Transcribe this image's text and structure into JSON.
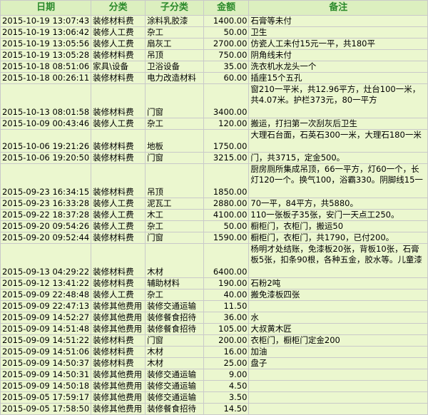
{
  "columns": [
    "日期",
    "分类",
    "子分类",
    "金额",
    "备注"
  ],
  "rows": [
    {
      "date": "2015-10-19 13:07:43",
      "category": "装修材料费",
      "subcategory": "涂料乳胶漆",
      "amount": "1400.00",
      "note": "石膏等未付"
    },
    {
      "date": "2015-10-19 13:06:42",
      "category": "装修人工费",
      "subcategory": "杂工",
      "amount": "50.00",
      "note": "卫生"
    },
    {
      "date": "2015-10-19 13:05:56",
      "category": "装修人工费",
      "subcategory": "扇灰工",
      "amount": "2700.00",
      "note": "仿瓷人工未付15元一平，共180平"
    },
    {
      "date": "2015-10-19 13:05:28",
      "category": "装修材料费",
      "subcategory": "吊顶",
      "amount": "750.00",
      "note": "阴角线未付"
    },
    {
      "date": "2015-10-18 08:51:06",
      "category": "家具\\设备",
      "subcategory": "卫浴设备",
      "amount": "35.00",
      "note": "洗衣机水龙头一个"
    },
    {
      "date": "2015-10-18 00:26:11",
      "category": "装修材料费",
      "subcategory": "电力改造材料",
      "amount": "60.00",
      "note": "插座15个五孔"
    },
    {
      "date": "2015-10-13 08:01:58",
      "category": "装修材料费",
      "subcategory": "门窗",
      "amount": "3400.00",
      "note": "窗210一平米，共12.96平方，灶台100一米，共4.07米。护栏373元，80一平方"
    },
    {
      "date": "2015-10-09 00:43:46",
      "category": "装修人工费",
      "subcategory": "杂工",
      "amount": "120.00",
      "note": "搬运，打扫第一次刮灰后卫生"
    },
    {
      "date": "2015-10-06 19:21:26",
      "category": "装修材料费",
      "subcategory": "地板",
      "amount": "1750.00",
      "note": "大理石台面，石英石300一米，大理石180一米"
    },
    {
      "date": "2015-10-06 19:20:50",
      "category": "装修材料费",
      "subcategory": "门窗",
      "amount": "3215.00",
      "note": "门，共3715，定金500。"
    },
    {
      "date": "2015-09-23 16:34:15",
      "category": "装修材料费",
      "subcategory": "吊顶",
      "amount": "1850.00",
      "note": "厨房厕所集成吊顶，66一平方，灯60一个，长灯120一个。换气100，浴霸330。阴脚线15一"
    },
    {
      "date": "2015-09-23 16:33:28",
      "category": "装修人工费",
      "subcategory": "泥瓦工",
      "amount": "2880.00",
      "note": "70一平，84平方，共5880。"
    },
    {
      "date": "2015-09-22 18:37:28",
      "category": "装修人工费",
      "subcategory": "木工",
      "amount": "4100.00",
      "note": "110一张板子35张，安门一天点工250。"
    },
    {
      "date": "2015-09-20 09:54:26",
      "category": "装修人工费",
      "subcategory": "杂工",
      "amount": "50.00",
      "note": "橱柜门，衣柜门，搬运50"
    },
    {
      "date": "2015-09-20 09:52:44",
      "category": "装修材料费",
      "subcategory": "门窗",
      "amount": "1590.00",
      "note": "橱柜门，衣柜门，共1790，已付200。"
    },
    {
      "date": "2015-09-13 04:29:22",
      "category": "装修材料费",
      "subcategory": "木材",
      "amount": "6400.00",
      "note": "杨明才处结账，免漆板20张，背板10张，石膏板5张，扣条90根，各种五金，胶水等。儿童漆"
    },
    {
      "date": "2015-09-12 13:41:22",
      "category": "装修材料费",
      "subcategory": "辅助材料",
      "amount": "190.00",
      "note": "石粉2吨"
    },
    {
      "date": "2015-09-09 22:48:48",
      "category": "装修人工费",
      "subcategory": "杂工",
      "amount": "40.00",
      "note": "搬免漆板四张"
    },
    {
      "date": "2015-09-09 22:47:13",
      "category": "装修其他费用",
      "subcategory": "装修交通运输",
      "amount": "11.50",
      "note": ""
    },
    {
      "date": "2015-09-09 14:52:27",
      "category": "装修其他费用",
      "subcategory": "装修餐食招待",
      "amount": "36.00",
      "note": "水"
    },
    {
      "date": "2015-09-09 14:51:48",
      "category": "装修其他费用",
      "subcategory": "装修餐食招待",
      "amount": "105.00",
      "note": "大叔黄木匠"
    },
    {
      "date": "2015-09-09 14:51:22",
      "category": "装修材料费",
      "subcategory": "门窗",
      "amount": "200.00",
      "note": "衣柜门，橱柜门定金200"
    },
    {
      "date": "2015-09-09 14:51:06",
      "category": "装修材料费",
      "subcategory": "木材",
      "amount": "16.00",
      "note": "加油"
    },
    {
      "date": "2015-09-09 14:50:37",
      "category": "装修材料费",
      "subcategory": "木材",
      "amount": "25.00",
      "note": "盘子"
    },
    {
      "date": "2015-09-09 14:50:31",
      "category": "装修其他费用",
      "subcategory": "装修交通运输",
      "amount": "9.00",
      "note": ""
    },
    {
      "date": "2015-09-09 14:50:18",
      "category": "装修其他费用",
      "subcategory": "装修交通运输",
      "amount": "4.50",
      "note": ""
    },
    {
      "date": "2015-09-05 17:59:17",
      "category": "装修其他费用",
      "subcategory": "装修交通运输",
      "amount": "3.50",
      "note": ""
    },
    {
      "date": "2015-09-05 17:58:50",
      "category": "装修其他费用",
      "subcategory": "装修餐食招待",
      "amount": "14.50",
      "note": ""
    }
  ],
  "colors": {
    "header_bg": "#dcefbf",
    "header_text": "#2b8a2b",
    "row_bg": "#ebf7cf",
    "grid": "#c9c9c9"
  }
}
